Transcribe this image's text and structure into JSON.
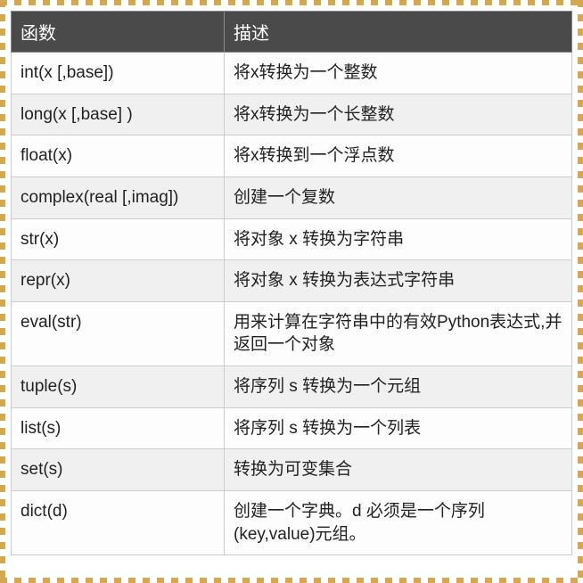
{
  "table": {
    "headers": {
      "func": "函数",
      "desc": "描述"
    },
    "rows": [
      {
        "func": "int(x [,base])",
        "desc": "将x转换为一个整数"
      },
      {
        "func": "long(x [,base] )",
        "desc": "将x转换为一个长整数"
      },
      {
        "func": "float(x)",
        "desc": "将x转换到一个浮点数"
      },
      {
        "func": "complex(real [,imag])",
        "desc": "创建一个复数"
      },
      {
        "func": "str(x)",
        "desc": "将对象 x 转换为字符串"
      },
      {
        "func": "repr(x)",
        "desc": "将对象 x 转换为表达式字符串"
      },
      {
        "func": "eval(str)",
        "desc": "用来计算在字符串中的有效Python表达式,并返回一个对象"
      },
      {
        "func": "tuple(s)",
        "desc": "将序列 s 转换为一个元组"
      },
      {
        "func": "list(s)",
        "desc": "将序列 s 转换为一个列表"
      },
      {
        "func": "set(s)",
        "desc": "转换为可变集合"
      },
      {
        "func": "dict(d)",
        "desc": "创建一个字典。d 必须是一个序列 (key,value)元组。"
      }
    ]
  }
}
